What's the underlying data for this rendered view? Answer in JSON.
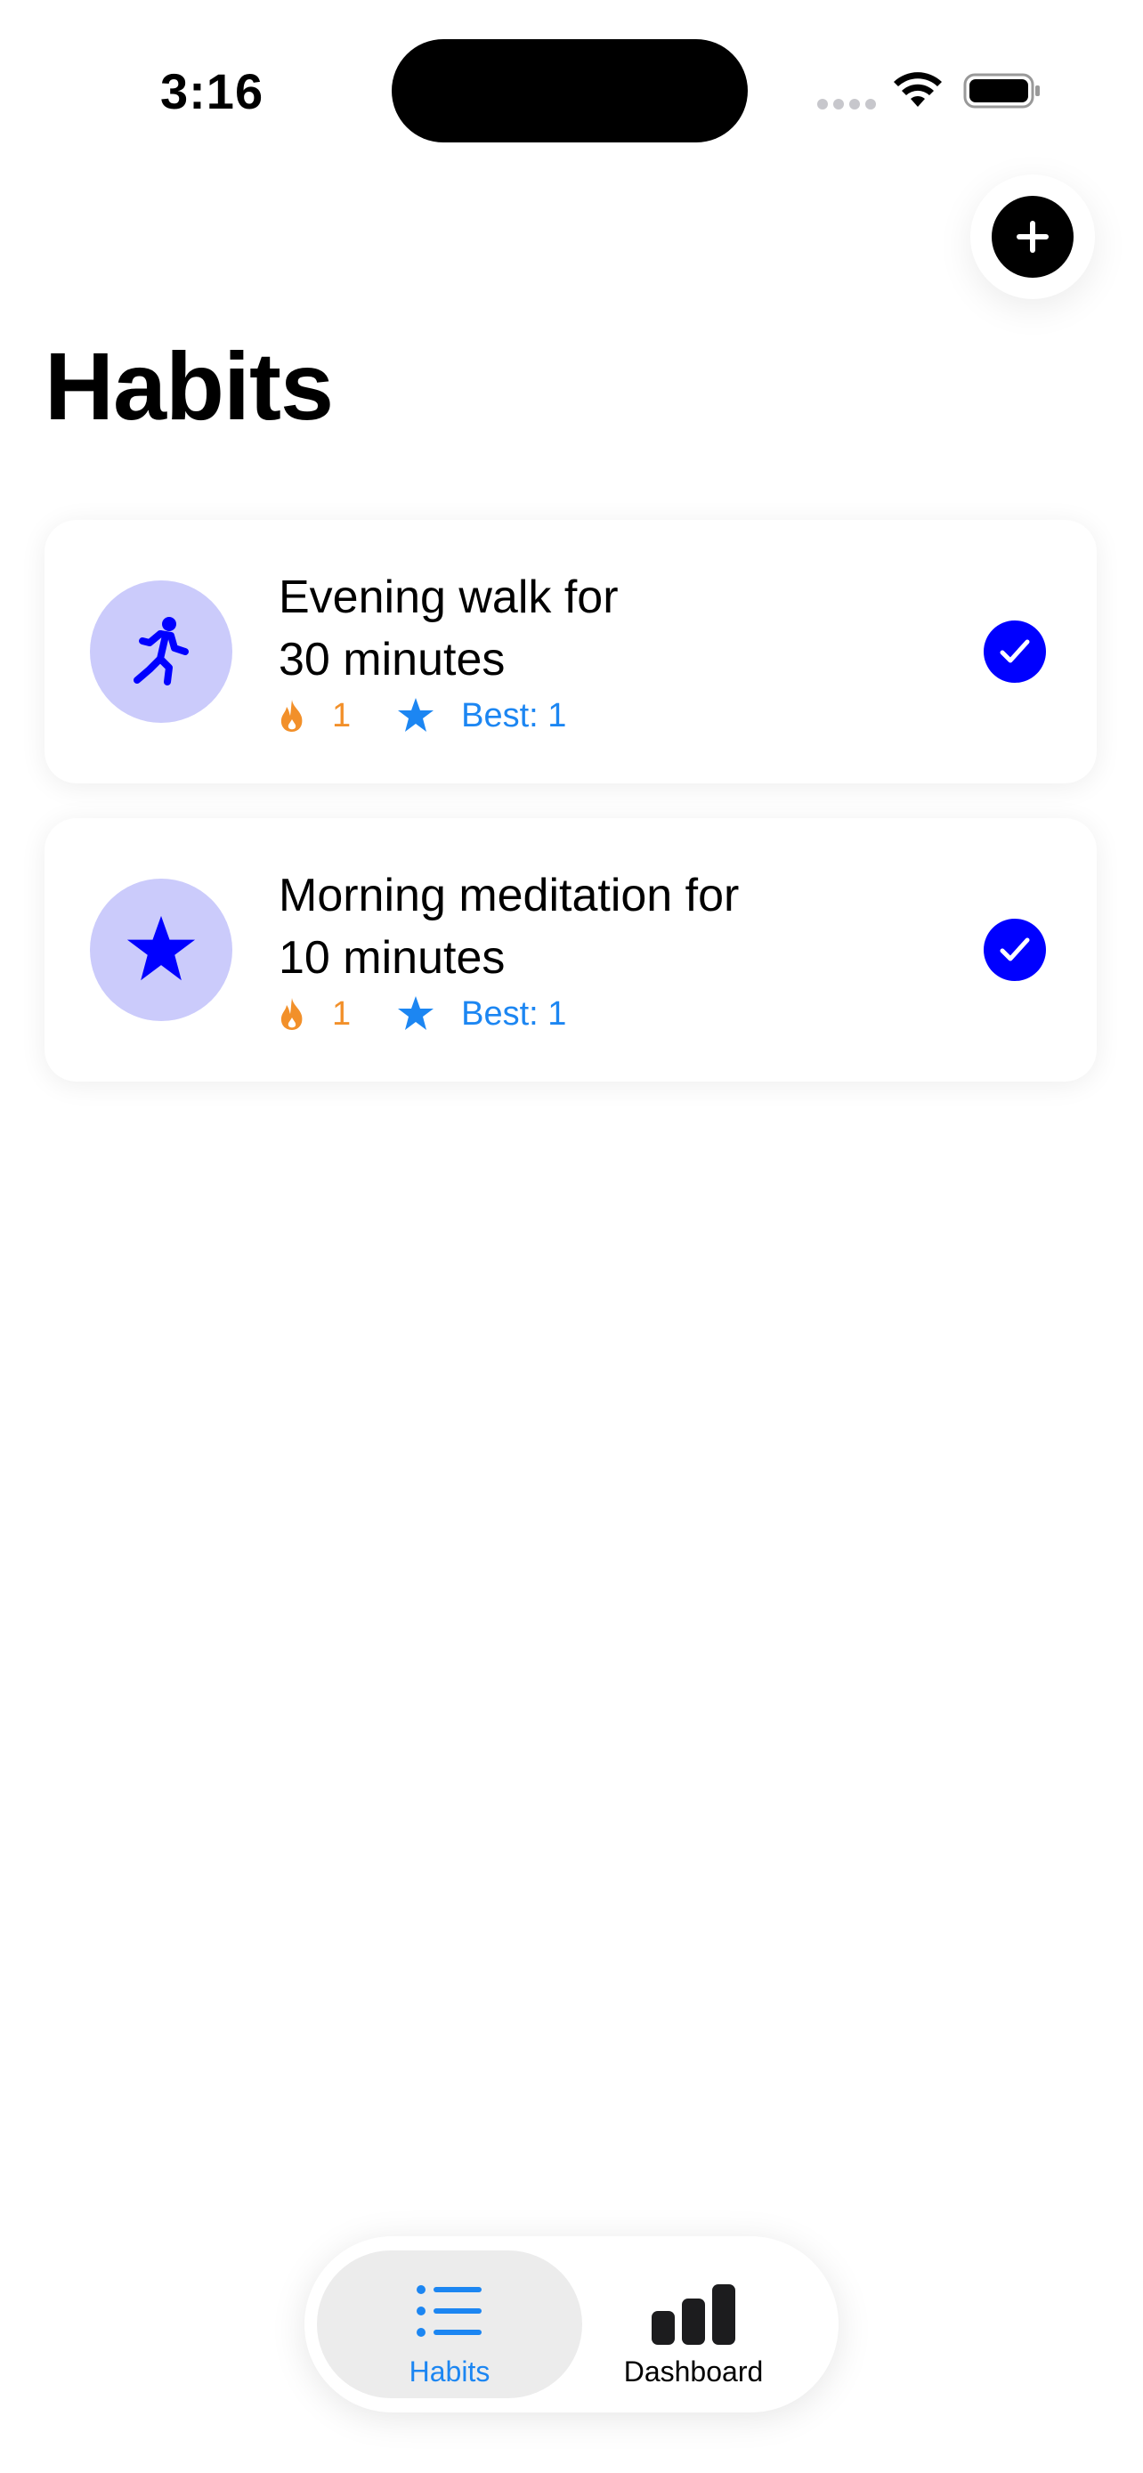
{
  "status_bar": {
    "time": "3:16"
  },
  "header": {
    "title": "Habits",
    "add_button_icon": "plus-icon"
  },
  "habits": [
    {
      "title_line1": "Evening walk for",
      "title_line2": "30 minutes",
      "icon": "running-figure-icon",
      "streak": "1",
      "best": "Best: 1",
      "completed": true
    },
    {
      "title_line1": "Morning meditation for",
      "title_line2": "10 minutes",
      "icon": "star-icon",
      "streak": "1",
      "best": "Best: 1",
      "completed": true
    }
  ],
  "tabbar": {
    "tabs": [
      {
        "label": "Habits",
        "icon": "list-icon",
        "selected": true
      },
      {
        "label": "Dashboard",
        "icon": "bar-chart-icon",
        "selected": false
      }
    ]
  },
  "colors": {
    "accent_blue": "#0000ff",
    "icon_circle": "#cbcbfb",
    "streak_orange": "#f2902a",
    "best_blue": "#1c86f2",
    "tab_selected_bg": "#ececec"
  }
}
